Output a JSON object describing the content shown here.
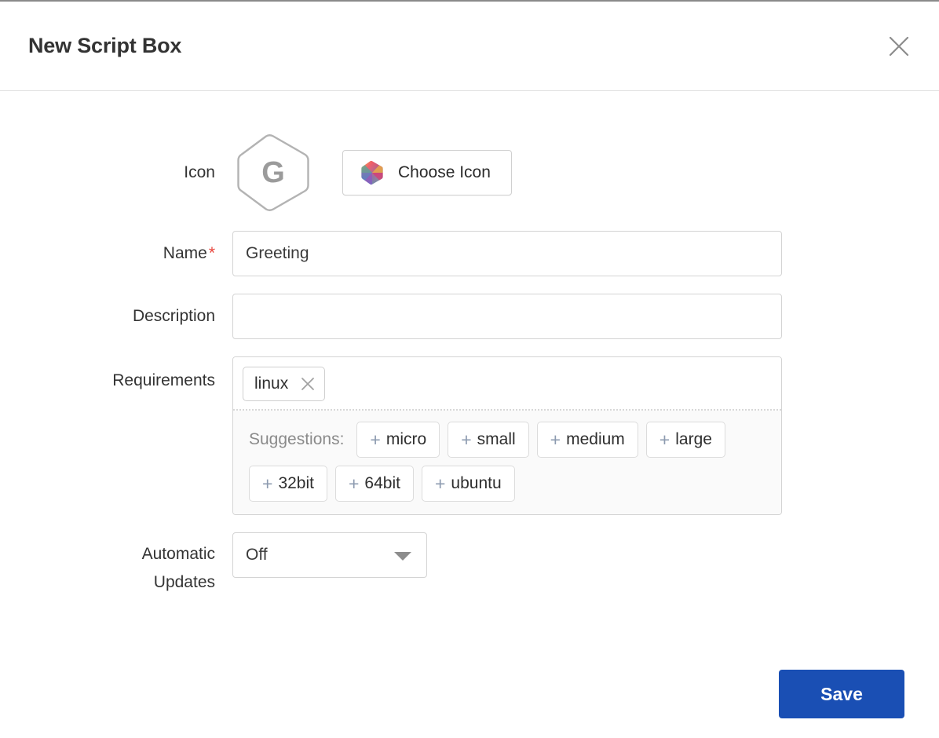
{
  "dialog": {
    "title": "New Script Box",
    "close_icon": "close-icon"
  },
  "form": {
    "icon": {
      "label": "Icon",
      "avatar_letter": "G",
      "choose_button_label": "Choose Icon",
      "choose_button_icon": "color-hexagon-icon"
    },
    "name": {
      "label": "Name",
      "required_marker": "*",
      "value": "Greeting",
      "placeholder": ""
    },
    "description": {
      "label": "Description",
      "value": "",
      "placeholder": ""
    },
    "requirements": {
      "label": "Requirements",
      "tags": [
        {
          "text": "linux",
          "remove_icon": "close-icon"
        }
      ],
      "suggestions_label": "Suggestions:",
      "suggestions": [
        {
          "prefix": "+",
          "text": "micro"
        },
        {
          "prefix": "+",
          "text": "small"
        },
        {
          "prefix": "+",
          "text": "medium"
        },
        {
          "prefix": "+",
          "text": "large"
        },
        {
          "prefix": "+",
          "text": "32bit"
        },
        {
          "prefix": "+",
          "text": "64bit"
        },
        {
          "prefix": "+",
          "text": "ubuntu"
        }
      ]
    },
    "automatic_updates": {
      "label_line1": "Automatic",
      "label_line2": "Updates",
      "value": "Off",
      "caret_icon": "chevron-down-icon"
    }
  },
  "footer": {
    "save_label": "Save"
  },
  "colors": {
    "accent": "#1a4fb4",
    "required": "#e8453c",
    "border": "#d4d4d4",
    "suggestion_plus": "#8d9bb0",
    "suggestion_bg": "#fafafa",
    "text": "#333333",
    "muted": "#8a8a8a"
  }
}
